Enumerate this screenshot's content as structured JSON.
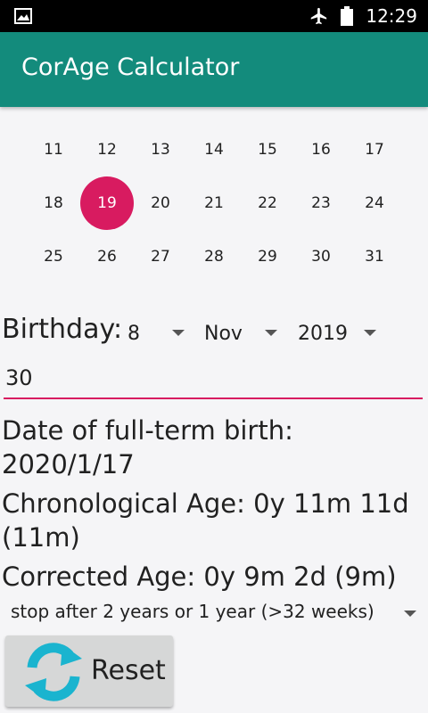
{
  "status_bar": {
    "time": "12:29"
  },
  "app_bar": {
    "title": "CorAge Calculator"
  },
  "calendar": {
    "rows": [
      [
        "11",
        "12",
        "13",
        "14",
        "15",
        "16",
        "17"
      ],
      [
        "18",
        "19",
        "20",
        "21",
        "22",
        "23",
        "24"
      ],
      [
        "25",
        "26",
        "27",
        "28",
        "29",
        "30",
        "31"
      ]
    ],
    "selected": "19",
    "selected_color": "#d81b60"
  },
  "birthday": {
    "label": "Birthday:",
    "day": "8",
    "month": "Nov",
    "year": "2019"
  },
  "gestation_weeks": {
    "value": "30"
  },
  "results": {
    "full_term_line1": "Date of full-term birth:",
    "full_term_line2": "2020/1/17",
    "chrono_line1": "Chronological Age: 0y 11m 11d",
    "chrono_line2": "(11m)",
    "corrected": "Corrected Age: 0y 9m 2d (9m)"
  },
  "stop_option": {
    "selected": "stop after 2 years or 1 year (>32 weeks)"
  },
  "reset_button": {
    "label": "Reset"
  },
  "colors": {
    "app_bar": "#138b7c",
    "accent": "#d81b60",
    "reset_icon": "#1ab4cf"
  }
}
